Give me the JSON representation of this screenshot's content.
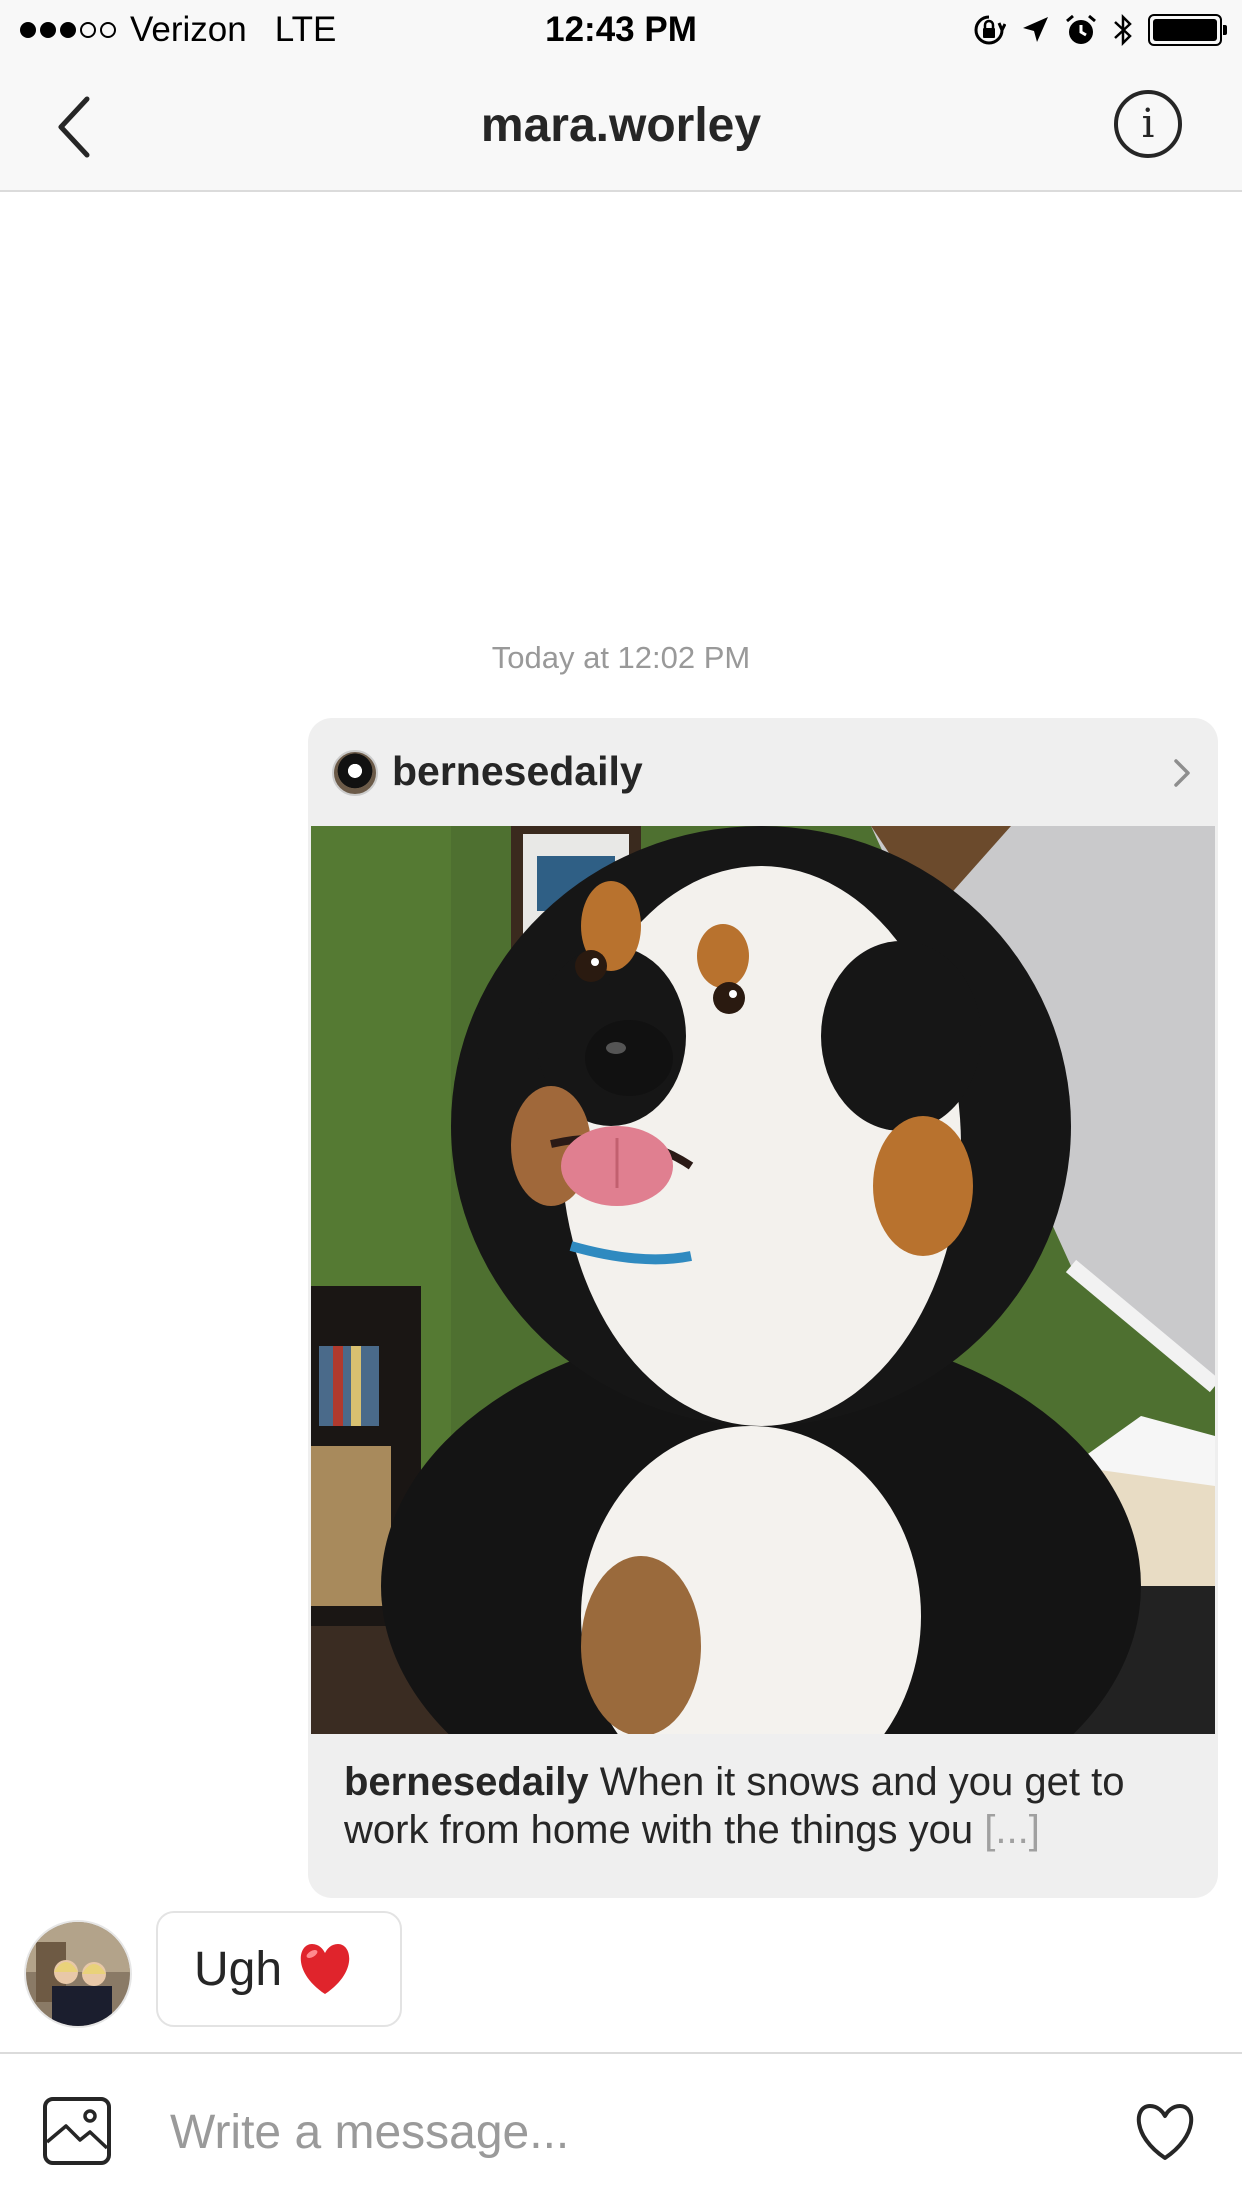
{
  "status_bar": {
    "carrier": "Verizon",
    "network": "LTE",
    "time": "12:43 PM",
    "signal_bars_filled": 3,
    "signal_bars_total": 5,
    "icons": [
      "orientation-lock-icon",
      "location-arrow-icon",
      "alarm-icon",
      "bluetooth-icon",
      "battery-icon"
    ]
  },
  "nav": {
    "title": "mara.worley",
    "back_icon": "chevron-left-icon",
    "info_label": "i"
  },
  "thread": {
    "timestamp": "Today at 12:02 PM",
    "shared_post": {
      "username": "bernesedaily",
      "caption_user": "bernesedaily",
      "caption_text": " When it snows and you get to work from home with the things you ",
      "caption_more": "[...]",
      "chevron_icon": "chevron-right-icon"
    },
    "received_message": {
      "text": "Ugh",
      "emoji": "❤️"
    }
  },
  "composer": {
    "placeholder": "Write a message...",
    "photo_icon": "image-icon",
    "like_icon": "heart-icon"
  },
  "colors": {
    "bar_background": "#f8f8f8",
    "divider": "#dbdbdb",
    "card_background": "#efefef",
    "text_primary": "#262626",
    "text_secondary": "#999999",
    "heart_red": "#e0242c"
  }
}
